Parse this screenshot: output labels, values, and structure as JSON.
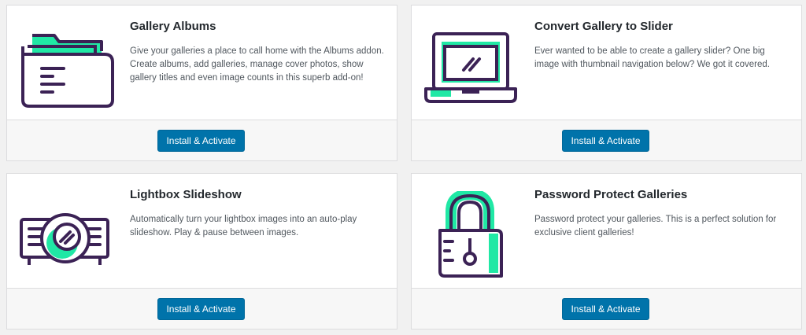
{
  "colors": {
    "accent": "#0073aa",
    "icon_outline": "#3b2255",
    "icon_fill": "#20e8a5"
  },
  "addons": [
    {
      "title": "Gallery Albums",
      "description": "Give your galleries a place to call home with the Albums addon. Create albums, add galleries, manage cover photos, show gallery titles and even image counts in this superb add-on!",
      "button_label": "Install & Activate",
      "icon": "folder-icon"
    },
    {
      "title": "Convert Gallery to Slider",
      "description": "Ever wanted to be able to create a gallery slider? One big image with thumbnail navigation below? We got it covered.",
      "button_label": "Install & Activate",
      "icon": "laptop-icon"
    },
    {
      "title": "Lightbox Slideshow",
      "description": "Automatically turn your lightbox images into an auto-play slideshow. Play & pause between images.",
      "button_label": "Install & Activate",
      "icon": "projector-icon"
    },
    {
      "title": "Password Protect Galleries",
      "description": "Password protect your galleries. This is a perfect solution for exclusive client galleries!",
      "button_label": "Install & Activate",
      "icon": "padlock-icon"
    }
  ]
}
